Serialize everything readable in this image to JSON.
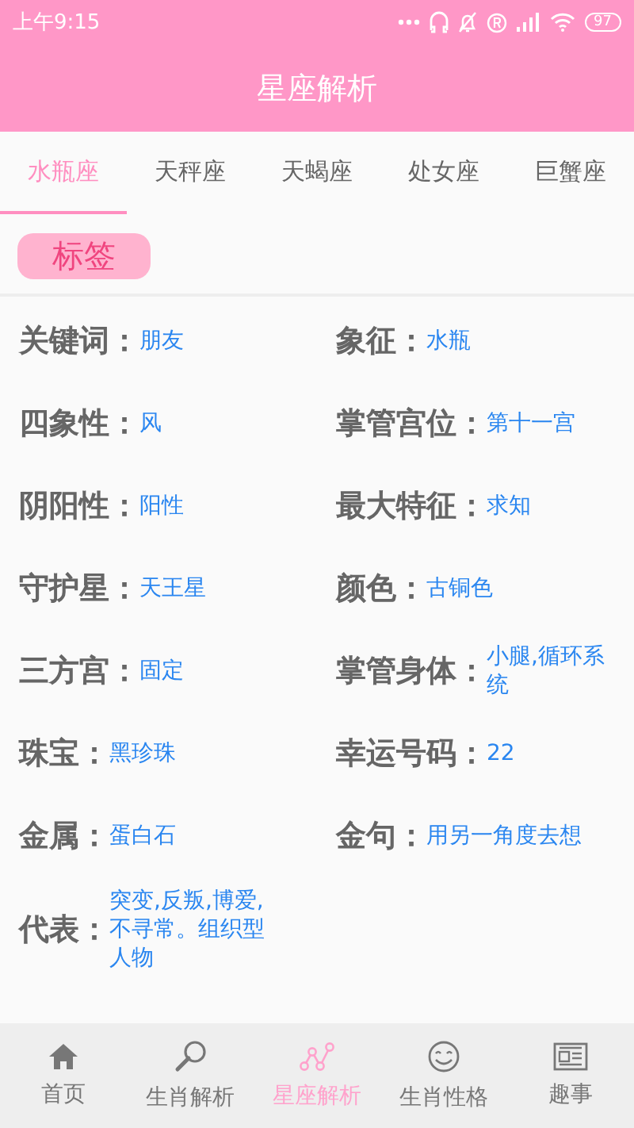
{
  "status_bar": {
    "time": "上午9:15",
    "battery": "97"
  },
  "title": "星座解析",
  "tabs": [
    {
      "label": "水瓶座",
      "selected": true
    },
    {
      "label": "天秤座",
      "selected": false
    },
    {
      "label": "天蝎座",
      "selected": false
    },
    {
      "label": "处女座",
      "selected": false
    },
    {
      "label": "巨蟹座",
      "selected": false
    }
  ],
  "tag": "标签",
  "fields": [
    {
      "label": "关键词：",
      "value": "朋友"
    },
    {
      "label": "象征：",
      "value": "水瓶"
    },
    {
      "label": "四象性：",
      "value": "风"
    },
    {
      "label": "掌管宫位：",
      "value": "第十一宫"
    },
    {
      "label": "阴阳性：",
      "value": "阳性"
    },
    {
      "label": "最大特征：",
      "value": "求知"
    },
    {
      "label": "守护星：",
      "value": "天王星"
    },
    {
      "label": "颜色：",
      "value": "古铜色"
    },
    {
      "label": "三方宫：",
      "value": "固定"
    },
    {
      "label": "掌管身体：",
      "value": "小腿,循环系统"
    },
    {
      "label": "珠宝：",
      "value": "黑珍珠"
    },
    {
      "label": "幸运号码：",
      "value": "22"
    },
    {
      "label": "金属：",
      "value": "蛋白石"
    },
    {
      "label": "金句：",
      "value": "用另一角度去想"
    },
    {
      "label": "代表：",
      "value": "突变,反叛,博爱,不寻常。组织型人物"
    }
  ],
  "nav": [
    {
      "label": "首页",
      "kind": "home",
      "selected": false
    },
    {
      "label": "生肖解析",
      "kind": "search",
      "selected": false
    },
    {
      "label": "星座解析",
      "kind": "graph",
      "selected": true
    },
    {
      "label": "生肖性格",
      "kind": "face",
      "selected": false
    },
    {
      "label": "趣事",
      "kind": "news",
      "selected": false
    }
  ]
}
